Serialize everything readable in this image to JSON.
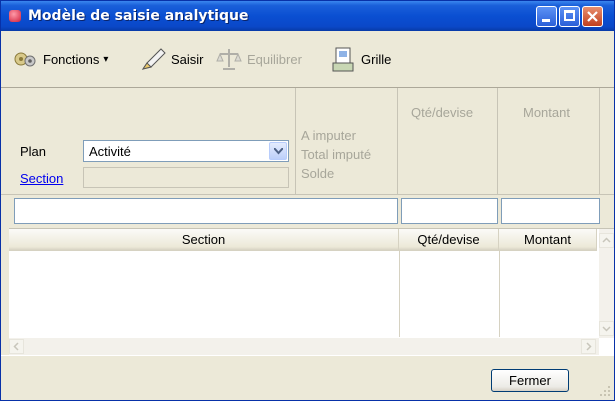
{
  "window": {
    "title": "Modèle de saisie analytique"
  },
  "toolbar": {
    "functions_label": "Fonctions",
    "enter_label": "Saisir",
    "balance_label": "Equilibrer",
    "grid_label": "Grille"
  },
  "form": {
    "plan_label": "Plan",
    "plan_value": "Activité",
    "section_link": "Section",
    "to_impute_label": "A imputer",
    "total_imputed_label": "Total imputé",
    "balance_label": "Solde",
    "qty_currency_header": "Qté/devise",
    "amount_header": "Montant"
  },
  "grid": {
    "columns": [
      "Section",
      "Qté/devise",
      "Montant"
    ],
    "rows": []
  },
  "footer": {
    "close_label": "Fermer"
  },
  "colors": {
    "titlebar": "#0a4fd2",
    "link": "#0000ee",
    "disabled_text": "#a7a69a"
  },
  "icons": [
    "app-icon",
    "functions-icon",
    "pen-icon",
    "balance-icon",
    "grid-icon",
    "dropdown-arrow-icon"
  ]
}
